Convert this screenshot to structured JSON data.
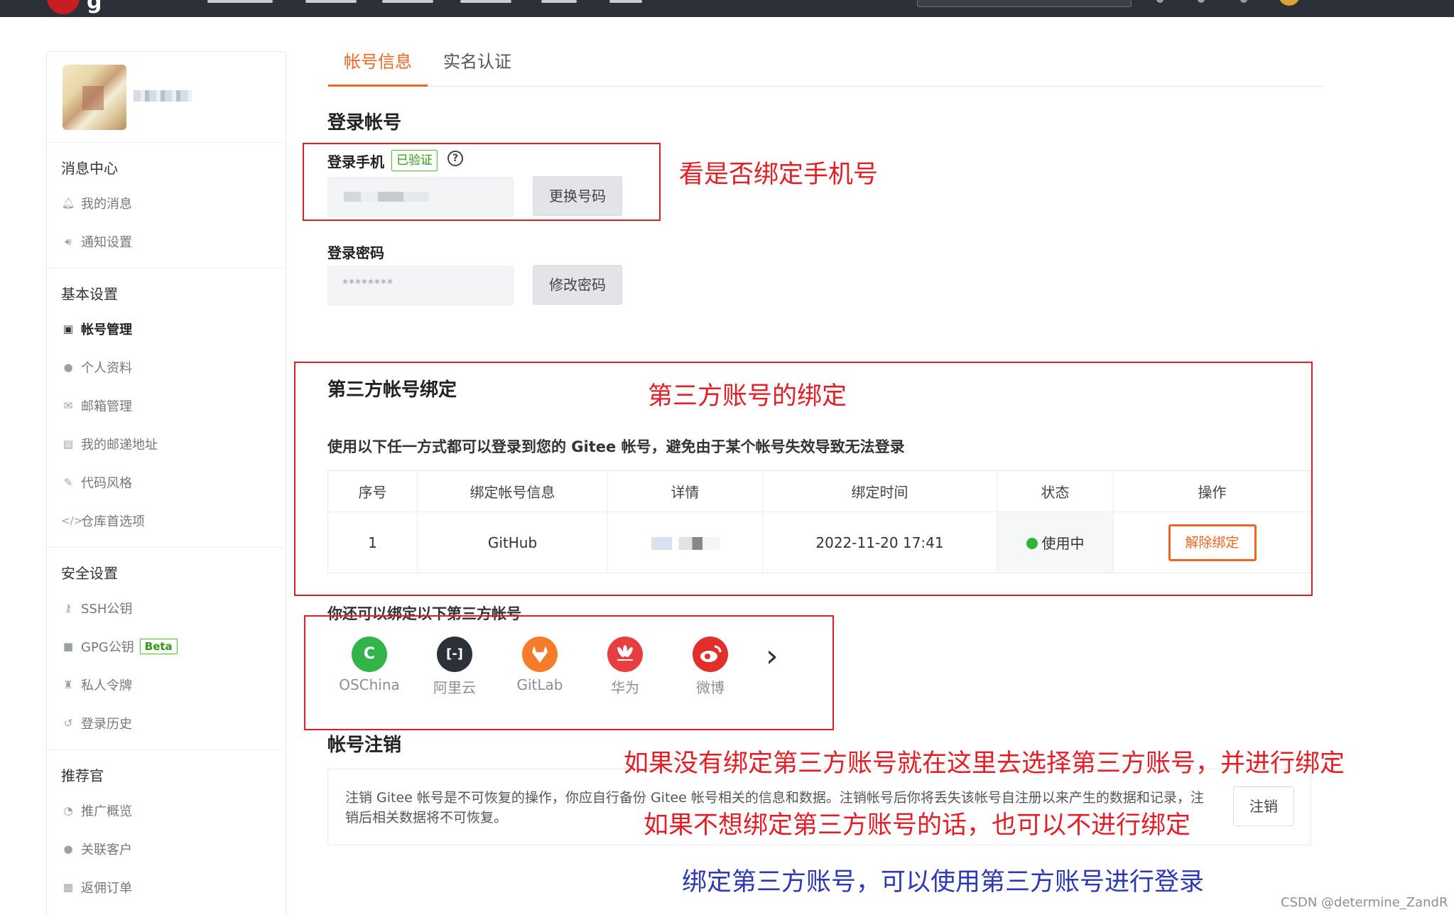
{
  "tabs": {
    "account_info": "帐号信息",
    "real_name": "实名认证"
  },
  "sidebar": {
    "groups": [
      {
        "title": "消息中心",
        "items": [
          {
            "label": "我的消息",
            "icon": "bell-icon"
          },
          {
            "label": "通知设置",
            "icon": "speaker-icon"
          }
        ]
      },
      {
        "title": "基本设置",
        "items": [
          {
            "label": "帐号管理",
            "icon": "id-card-icon",
            "active": true
          },
          {
            "label": "个人资料",
            "icon": "user-icon"
          },
          {
            "label": "邮箱管理",
            "icon": "mail-icon"
          },
          {
            "label": "我的邮递地址",
            "icon": "address-card-icon"
          },
          {
            "label": "代码风格",
            "icon": "brush-icon"
          },
          {
            "label": "仓库首选项",
            "icon": "code-icon"
          }
        ]
      },
      {
        "title": "安全设置",
        "items": [
          {
            "label": "SSH公钥",
            "icon": "key-icon"
          },
          {
            "label": "GPG公钥",
            "icon": "lock-icon",
            "badge": "Beta"
          },
          {
            "label": "私人令牌",
            "icon": "token-icon"
          },
          {
            "label": "登录历史",
            "icon": "history-icon"
          }
        ]
      },
      {
        "title": "推荐官",
        "items": [
          {
            "label": "推广概览",
            "icon": "dashboard-icon"
          },
          {
            "label": "关联客户",
            "icon": "user-link-icon"
          },
          {
            "label": "返佣订单",
            "icon": "order-icon"
          }
        ]
      }
    ]
  },
  "login": {
    "section_title": "登录帐号",
    "phone_label": "登录手机",
    "verified_badge": "已验证",
    "help_glyph": "?",
    "change_phone_button": "更换号码",
    "password_label": "登录密码",
    "password_value": "********",
    "change_password_button": "修改密码"
  },
  "third_party": {
    "section_title": "第三方帐号绑定",
    "description": "使用以下任一方式都可以登录到您的 Gitee 帐号，避免由于某个帐号失效导致无法登录",
    "table": {
      "headers": [
        "序号",
        "绑定帐号信息",
        "详情",
        "绑定时间",
        "状态",
        "操作"
      ],
      "rows": [
        {
          "index": "1",
          "account": "GitHub",
          "time": "2022-11-20 17:41",
          "status": "使用中",
          "action": "解除绑定"
        }
      ]
    },
    "more_title": "你还可以绑定以下第三方帐号",
    "providers": [
      {
        "name": "OSChina",
        "glyph": "C",
        "color": "#32b44a"
      },
      {
        "name": "阿里云",
        "glyph": "[-]",
        "color": "#2c3038"
      },
      {
        "name": "GitLab",
        "glyph": "",
        "color": "#f57c2b"
      },
      {
        "name": "华为",
        "glyph": "",
        "color": "#e73f3f"
      },
      {
        "name": "微博",
        "glyph": "",
        "color": "#e0302a"
      }
    ],
    "next_glyph": "›"
  },
  "cancel": {
    "section_title": "帐号注销",
    "text": "注销 Gitee 帐号是不可恢复的操作，你应自行备份 Gitee 帐号相关的信息和数据。注销帐号后你将丢失该帐号自注册以来产生的数据和记录，注销后相关数据将不可恢复。",
    "button": "注销"
  },
  "annotations": {
    "phone": "看是否绑定手机号",
    "third_party": "第三方账号的绑定",
    "choose": "如果没有绑定第三方账号就在这里去选择第三方账号，并进行绑定",
    "optional": "如果不想绑定第三方账号的话，也可以不进行绑定",
    "benefit": "绑定第三方账号，可以使用第三方账号进行登录"
  },
  "watermark": "CSDN @determine_ZandR",
  "colors": {
    "accent": "#f16522",
    "annotation_red": "#e41e26",
    "annotation_blue": "#2d39b3",
    "success": "#2fb43a"
  }
}
